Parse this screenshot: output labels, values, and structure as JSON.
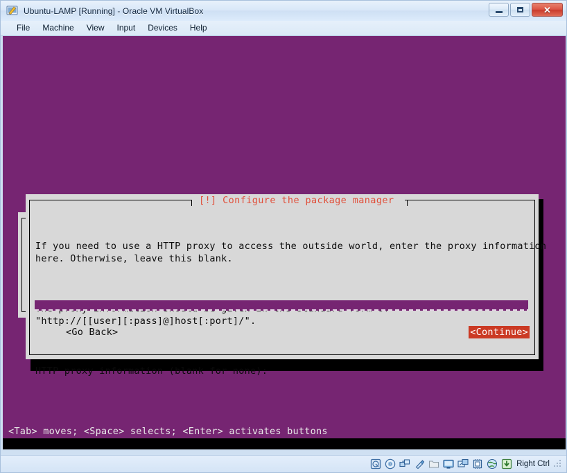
{
  "window": {
    "title": "Ubuntu-LAMP [Running] - Oracle VM VirtualBox",
    "icon": "virtualbox-vm-icon",
    "controls": {
      "minimize": "minimize-icon",
      "maximize": "maximize-icon",
      "close": "✕"
    }
  },
  "menubar": {
    "items": [
      {
        "label": "File"
      },
      {
        "label": "Machine"
      },
      {
        "label": "View"
      },
      {
        "label": "Input"
      },
      {
        "label": "Devices"
      },
      {
        "label": "Help"
      }
    ]
  },
  "console": {
    "background_color": "#762572",
    "help_line": "<Tab> moves; <Space> selects; <Enter> activates buttons"
  },
  "dialog": {
    "title": "[!] Configure the package manager",
    "title_color": "#e14f3a",
    "paragraphs": [
      "If you need to use a HTTP proxy to access the outside world, enter the proxy information\nhere. Otherwise, leave this blank.",
      "The proxy information should be given in the standard form of\n\"http://[[user][:pass]@]host[:port]/\".",
      "HTTP proxy information (blank for none):"
    ],
    "input": {
      "value": "",
      "placeholder": "",
      "background_color": "#762572"
    },
    "buttons": [
      {
        "label": "<Go Back>",
        "selected": false
      },
      {
        "label": "<Continue>",
        "selected": true,
        "highlight_color": "#cb3a24"
      }
    ]
  },
  "statusbar": {
    "icons": [
      {
        "name": "hard-disk-icon"
      },
      {
        "name": "optical-disk-icon"
      },
      {
        "name": "network-icon"
      },
      {
        "name": "usb-icon"
      },
      {
        "name": "shared-folder-icon"
      },
      {
        "name": "display-icon"
      },
      {
        "name": "remote-desktop-icon"
      },
      {
        "name": "cpu-icon"
      },
      {
        "name": "globe-icon"
      },
      {
        "name": "host-key-icon"
      }
    ],
    "host_key_label": "Right Ctrl"
  }
}
